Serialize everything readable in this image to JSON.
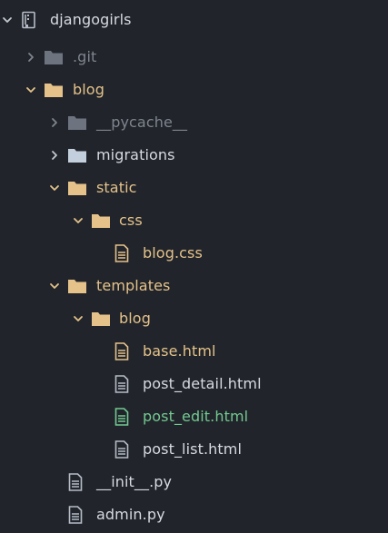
{
  "colors": {
    "background": "#21252b",
    "text_default": "#d7dae0",
    "text_ignored": "#7f848e",
    "text_added": "#73c991",
    "folder": "#e5c28a",
    "folder_ignored": "#6d7480",
    "folder_migrations": "#c4cfdd",
    "file_icon": "#b6bcc6",
    "chevron": "#c3c8d0"
  },
  "tree": {
    "root": {
      "label": "djangogirls",
      "icon": "repo-icon",
      "expanded": true
    },
    "items": [
      {
        "label": ".git",
        "type": "folder",
        "expanded": false,
        "status": "ignored"
      },
      {
        "label": "blog",
        "type": "folder",
        "expanded": true,
        "status": "normal"
      },
      {
        "label": "__pycache__",
        "type": "folder",
        "expanded": false,
        "status": "ignored"
      },
      {
        "label": "migrations",
        "type": "folder",
        "expanded": false,
        "status": "normal"
      },
      {
        "label": "static",
        "type": "folder",
        "expanded": true,
        "status": "normal"
      },
      {
        "label": "css",
        "type": "folder",
        "expanded": true,
        "status": "normal"
      },
      {
        "label": "blog.css",
        "type": "file",
        "status": "modified"
      },
      {
        "label": "templates",
        "type": "folder",
        "expanded": true,
        "status": "normal"
      },
      {
        "label": "blog",
        "type": "folder",
        "expanded": true,
        "status": "normal"
      },
      {
        "label": "base.html",
        "type": "file",
        "status": "modified"
      },
      {
        "label": "post_detail.html",
        "type": "file",
        "status": "normal"
      },
      {
        "label": "post_edit.html",
        "type": "file",
        "status": "added"
      },
      {
        "label": "post_list.html",
        "type": "file",
        "status": "normal"
      },
      {
        "label": "__init__.py",
        "type": "file",
        "status": "normal"
      },
      {
        "label": "admin.py",
        "type": "file",
        "status": "normal"
      }
    ]
  }
}
